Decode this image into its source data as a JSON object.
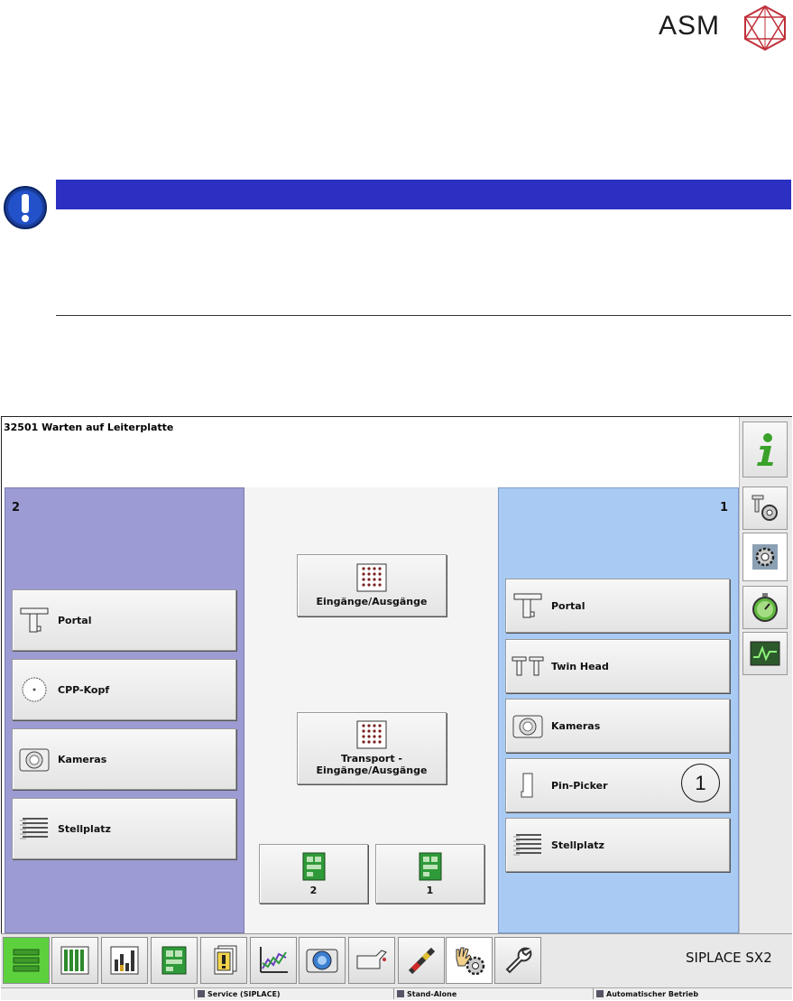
{
  "document": {
    "logo_text": "ASM"
  },
  "screen": {
    "status_message": "32501 Warten auf Leiterplatte",
    "left_panel": {
      "number": "2",
      "buttons": [
        {
          "label": "Portal",
          "icon": "portal-icon"
        },
        {
          "label": "CPP-Kopf",
          "icon": "cpp-head-icon"
        },
        {
          "label": "Kameras",
          "icon": "camera-icon"
        },
        {
          "label": "Stellplatz",
          "icon": "feeder-table-icon"
        }
      ]
    },
    "center_panel": {
      "io_label": "Eingänge/Ausgänge",
      "transport_io_label_1": "Transport -",
      "transport_io_label_2": "Eingänge/Ausgänge",
      "conveyor_buttons": [
        "2",
        "1"
      ]
    },
    "right_panel": {
      "number": "1",
      "buttons": [
        {
          "label": "Portal",
          "icon": "portal-icon"
        },
        {
          "label": "Twin Head",
          "icon": "twin-head-icon"
        },
        {
          "label": "Kameras",
          "icon": "camera-icon"
        },
        {
          "label": "Pin-Picker",
          "icon": "pin-picker-icon"
        },
        {
          "label": "Stellplatz",
          "icon": "feeder-table-icon"
        }
      ]
    },
    "sidebar": [
      "info-icon",
      "machine-settings-icon",
      "gear-icon",
      "stopwatch-icon",
      "oscilloscope-icon"
    ],
    "toolbar": [
      "production-icon",
      "feeder-grid-icon",
      "statistics-icon",
      "board-icon",
      "alarm-icon",
      "chart-icon",
      "vision-icon",
      "oil-can-icon",
      "nozzle-icon",
      "hand-gear-icon",
      "wrench-icon"
    ],
    "brand": "SIPLACE SX2",
    "statusbar": {
      "user": "Service (SIPLACE)",
      "line_mode": "Stand-Alone",
      "operation_mode": "Automatischer Betrieb"
    },
    "callout_number": "1"
  },
  "colors": {
    "notice_bar": "#2b2fc2",
    "left_panel": "#9c9bd3",
    "right_panel": "#a9cbf3"
  }
}
